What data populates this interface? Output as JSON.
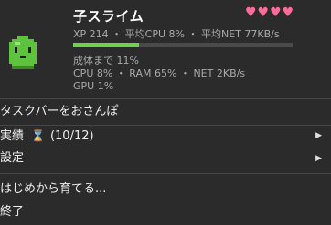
{
  "pet": {
    "name": "子スライム",
    "hearts": "♥♥♥♥",
    "stats_line": "XP 214 ・ 平均CPU 8% ・ 平均NET 77KB/s",
    "xp_progress": 0.3,
    "growth_text": "成体まで 11%",
    "usage_text": "CPU 8% ・ RAM 65% ・ NET 2KB/s",
    "gpu_text": "GPU 1%",
    "colors": {
      "slime": "#5ec23e",
      "hearts": "#ff6b9a",
      "xp_fill": "#6ed14a"
    }
  },
  "menu": {
    "walk_taskbar": "タスクバーをおさんぽ",
    "achievements_label": "実績",
    "achievements_icon": "hourglass-icon",
    "achievements_count": "(10/12)",
    "settings_label": "設定",
    "restart_label": "はじめから育てる...",
    "quit_label": "終了"
  }
}
